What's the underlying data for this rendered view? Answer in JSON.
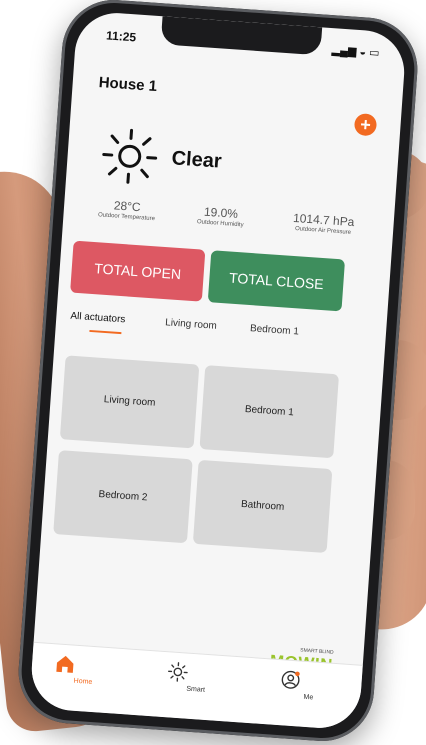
{
  "status": {
    "time": "11:25",
    "icons": "signal-wifi-battery"
  },
  "house": {
    "title": "House 1",
    "add_icon": "plus-icon"
  },
  "weather": {
    "condition": "Clear",
    "temperature": "28°C",
    "temperature_label": "Outdoor Temperature",
    "humidity": "19.0%",
    "humidity_label": "Outdoor Humidity",
    "pressure": "1014.7 hPa",
    "pressure_label": "Outdoor Air Pressure"
  },
  "actions": {
    "open_label": "TOTAL OPEN",
    "close_label": "TOTAL CLOSE"
  },
  "tabs": [
    {
      "label": "All actuators",
      "active": true
    },
    {
      "label": "Living room"
    },
    {
      "label": "Bedroom 1"
    }
  ],
  "rooms": [
    {
      "label": "Living room"
    },
    {
      "label": "Bedroom 1"
    },
    {
      "label": "Bedroom 2"
    },
    {
      "label": "Bathroom"
    }
  ],
  "brand": {
    "small": "SMART BLIND",
    "name": "MOWIN"
  },
  "tabbar": [
    {
      "label": "Home",
      "icon": "home-icon"
    },
    {
      "label": "Smart",
      "icon": "sun-icon"
    },
    {
      "label": "Me",
      "icon": "user-icon"
    }
  ],
  "colors": {
    "accent": "#f26a21",
    "open": "#dd5863",
    "close": "#3e8e5d",
    "brand": "#9ac42d"
  }
}
